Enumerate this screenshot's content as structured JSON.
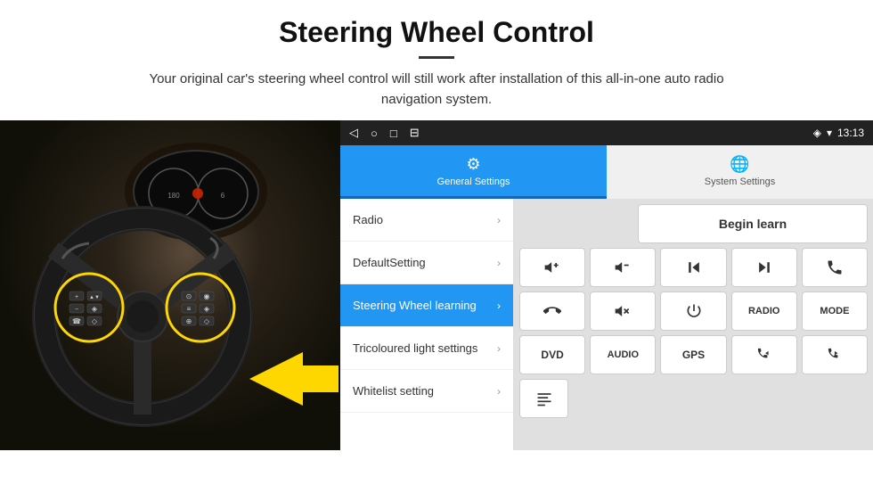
{
  "header": {
    "title": "Steering Wheel Control",
    "subtitle": "Your original car's steering wheel control will still work after installation of this all-in-one auto radio navigation system."
  },
  "status_bar": {
    "time": "13:13",
    "icons": [
      "◁",
      "○",
      "□",
      "⊟"
    ]
  },
  "tabs": [
    {
      "id": "general",
      "label": "General Settings",
      "active": true
    },
    {
      "id": "system",
      "label": "System Settings",
      "active": false
    }
  ],
  "menu_items": [
    {
      "id": "radio",
      "label": "Radio",
      "active": false
    },
    {
      "id": "default",
      "label": "DefaultSetting",
      "active": false
    },
    {
      "id": "steering",
      "label": "Steering Wheel learning",
      "active": true
    },
    {
      "id": "tricoloured",
      "label": "Tricoloured light settings",
      "active": false
    },
    {
      "id": "whitelist",
      "label": "Whitelist setting",
      "active": false
    }
  ],
  "buttons": {
    "begin_learn": "Begin learn",
    "rows": [
      [
        "vol+",
        "vol-",
        "prev",
        "next",
        "phone"
      ],
      [
        "hangup",
        "mute",
        "power",
        "RADIO",
        "MODE"
      ],
      [
        "DVD",
        "AUDIO",
        "GPS",
        "tel+prev",
        "tel+next"
      ]
    ]
  }
}
